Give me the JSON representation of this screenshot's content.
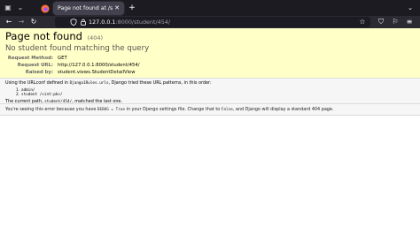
{
  "tab": {
    "title": "Page not found at /stu",
    "close_glyph": "✕",
    "new_tab_glyph": "+",
    "tab_list_glyph": "⌄"
  },
  "toolbar": {
    "back_glyph": "←",
    "forward_glyph": "→",
    "reload_glyph": "↻",
    "star_glyph": "☆",
    "pocket_glyph": "⛉",
    "extensions_glyph": "⚐",
    "menu_glyph": "≡"
  },
  "url": {
    "host": "127.0.0.1",
    "rest": ":8000/student/454/"
  },
  "page": {
    "title": "Page not found",
    "status_code": "(404)",
    "subtitle": "No student found matching the query",
    "meta": [
      {
        "label": "Request Method:",
        "value": "GET"
      },
      {
        "label": "Request URL:",
        "value": "http://127.0.0.1:8000/student/454/"
      },
      {
        "label": "Raised by:",
        "value": "student.views.StudentDetailView"
      }
    ],
    "info_intro_before": "Using the URLconf defined in ",
    "urlconf": "Django1Rules.urls",
    "info_intro_after": ", Django tried these URL patterns, in this order:",
    "patterns": [
      {
        "num": "1.",
        "pattern": "admin/"
      },
      {
        "num": "2.",
        "pattern": "student /<int:pk>/"
      }
    ],
    "current_path_before": "The current path, ",
    "current_path": "student/454/",
    "current_path_after": ", matched the last one.",
    "explanation_before": "You're seeing this error because you have ",
    "debug_setting": "DEBUG = True",
    "explanation_middle": " in your Django settings file. Change that to ",
    "false_value": "False",
    "explanation_after": ", and Django will display a standard 404 page."
  },
  "colors": {
    "browser_dark": "#1c1b22",
    "toolbar": "#2b2a33",
    "tab_active": "#42414d",
    "summary_bg": "#ffffc8",
    "info_bg": "#f6f6f6"
  }
}
